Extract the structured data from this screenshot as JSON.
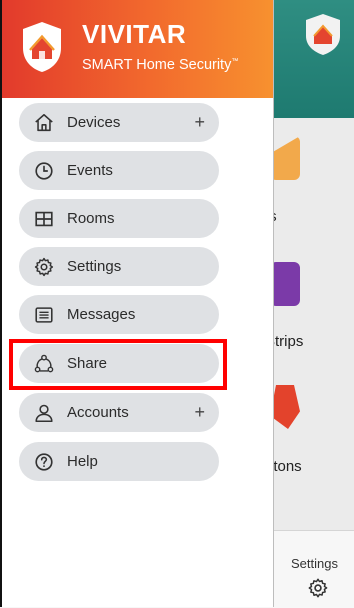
{
  "brand": {
    "name_bold": "VIVITAR",
    "tagline": "SMART Home Security",
    "tagline_mark": "™"
  },
  "menu": {
    "items": [
      {
        "label": "Devices",
        "icon": "home-icon",
        "expandable": true,
        "plus": "+"
      },
      {
        "label": "Events",
        "icon": "clock-icon",
        "expandable": false
      },
      {
        "label": "Rooms",
        "icon": "rooms-grid-icon",
        "expandable": false
      },
      {
        "label": "Settings",
        "icon": "gear-icon",
        "expandable": false
      },
      {
        "label": "Messages",
        "icon": "messages-icon",
        "expandable": false
      },
      {
        "label": "Share",
        "icon": "share-icon",
        "expandable": false,
        "highlighted": true
      },
      {
        "label": "Accounts",
        "icon": "user-icon",
        "expandable": true,
        "plus": "+"
      },
      {
        "label": "Help",
        "icon": "help-icon",
        "expandable": false
      }
    ]
  },
  "background_app": {
    "labels": [
      "ts",
      "Strips",
      "ıttons"
    ],
    "bottom_tab_label": "Settings"
  },
  "colors": {
    "header_gradient_start": "#e23a2c",
    "header_gradient_end": "#f7912f",
    "menu_pill": "#dfe1e4",
    "highlight_border": "#ff0000",
    "app_header_teal": "#1e7a70"
  }
}
